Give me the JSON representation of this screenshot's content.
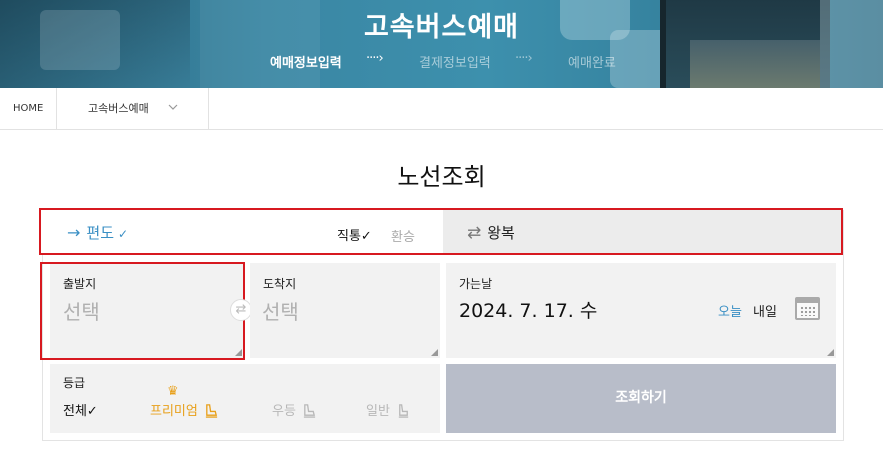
{
  "hero": {
    "title": "고속버스예매",
    "steps": [
      {
        "label": "예매정보입력",
        "active": true
      },
      {
        "label": "결제정보입력",
        "active": false
      },
      {
        "label": "예매완료",
        "active": false
      }
    ],
    "step_arrow": "····›"
  },
  "breadcrumb": {
    "home": "HOME",
    "current": "고속버스예매"
  },
  "page_title": "노선조회",
  "trip": {
    "oneway_arrow": "→",
    "oneway_label": "편도",
    "check": "✓",
    "direct_label": "직통✓",
    "transfer_label": "환승",
    "roundtrip_icon": "⇄",
    "roundtrip_label": "왕복"
  },
  "depart": {
    "label": "출발지",
    "value": "선택"
  },
  "arrive": {
    "label": "도착지",
    "value": "선택"
  },
  "swap_icon": "⇄",
  "date": {
    "label": "가는날",
    "value": "2024. 7. 17. 수",
    "today": "오늘",
    "tomorrow": "내일"
  },
  "grade": {
    "label": "등급",
    "all": "전체✓",
    "premium": "프리미엄",
    "superior": "우등",
    "standard": "일반",
    "crown": "♛"
  },
  "search_button": "조회하기",
  "colors": {
    "accent_blue": "#3a8fc4",
    "premium_gold": "#e8a01a",
    "highlight_red": "#d71920",
    "button_gray": "#b8bdc9"
  }
}
